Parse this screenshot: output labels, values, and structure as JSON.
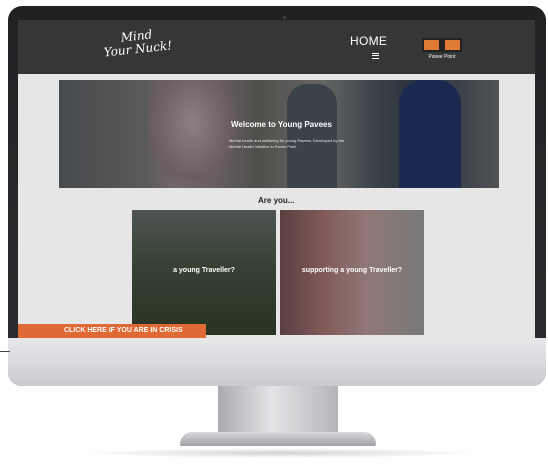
{
  "header": {
    "logo_text": "Mind\nYour Nuck!",
    "nav_home": "HOME",
    "badge_text": "Pavee Point"
  },
  "hero": {
    "title": "Welcome to Young Pavees",
    "subtitle": "Mental health and wellbeing for young Pavees. Developed by the Mental Health Initiative in Pavee Point"
  },
  "section_heading": "Are you...",
  "cards": [
    {
      "label": "a young Traveller?"
    },
    {
      "label": "supporting a young Traveller?"
    }
  ],
  "crisis_button": "CLICK HERE IF YOU ARE IN CRISIS",
  "colors": {
    "header_bg": "#353638",
    "accent_orange": "#e06a35",
    "page_bg": "#e6e6e6"
  }
}
